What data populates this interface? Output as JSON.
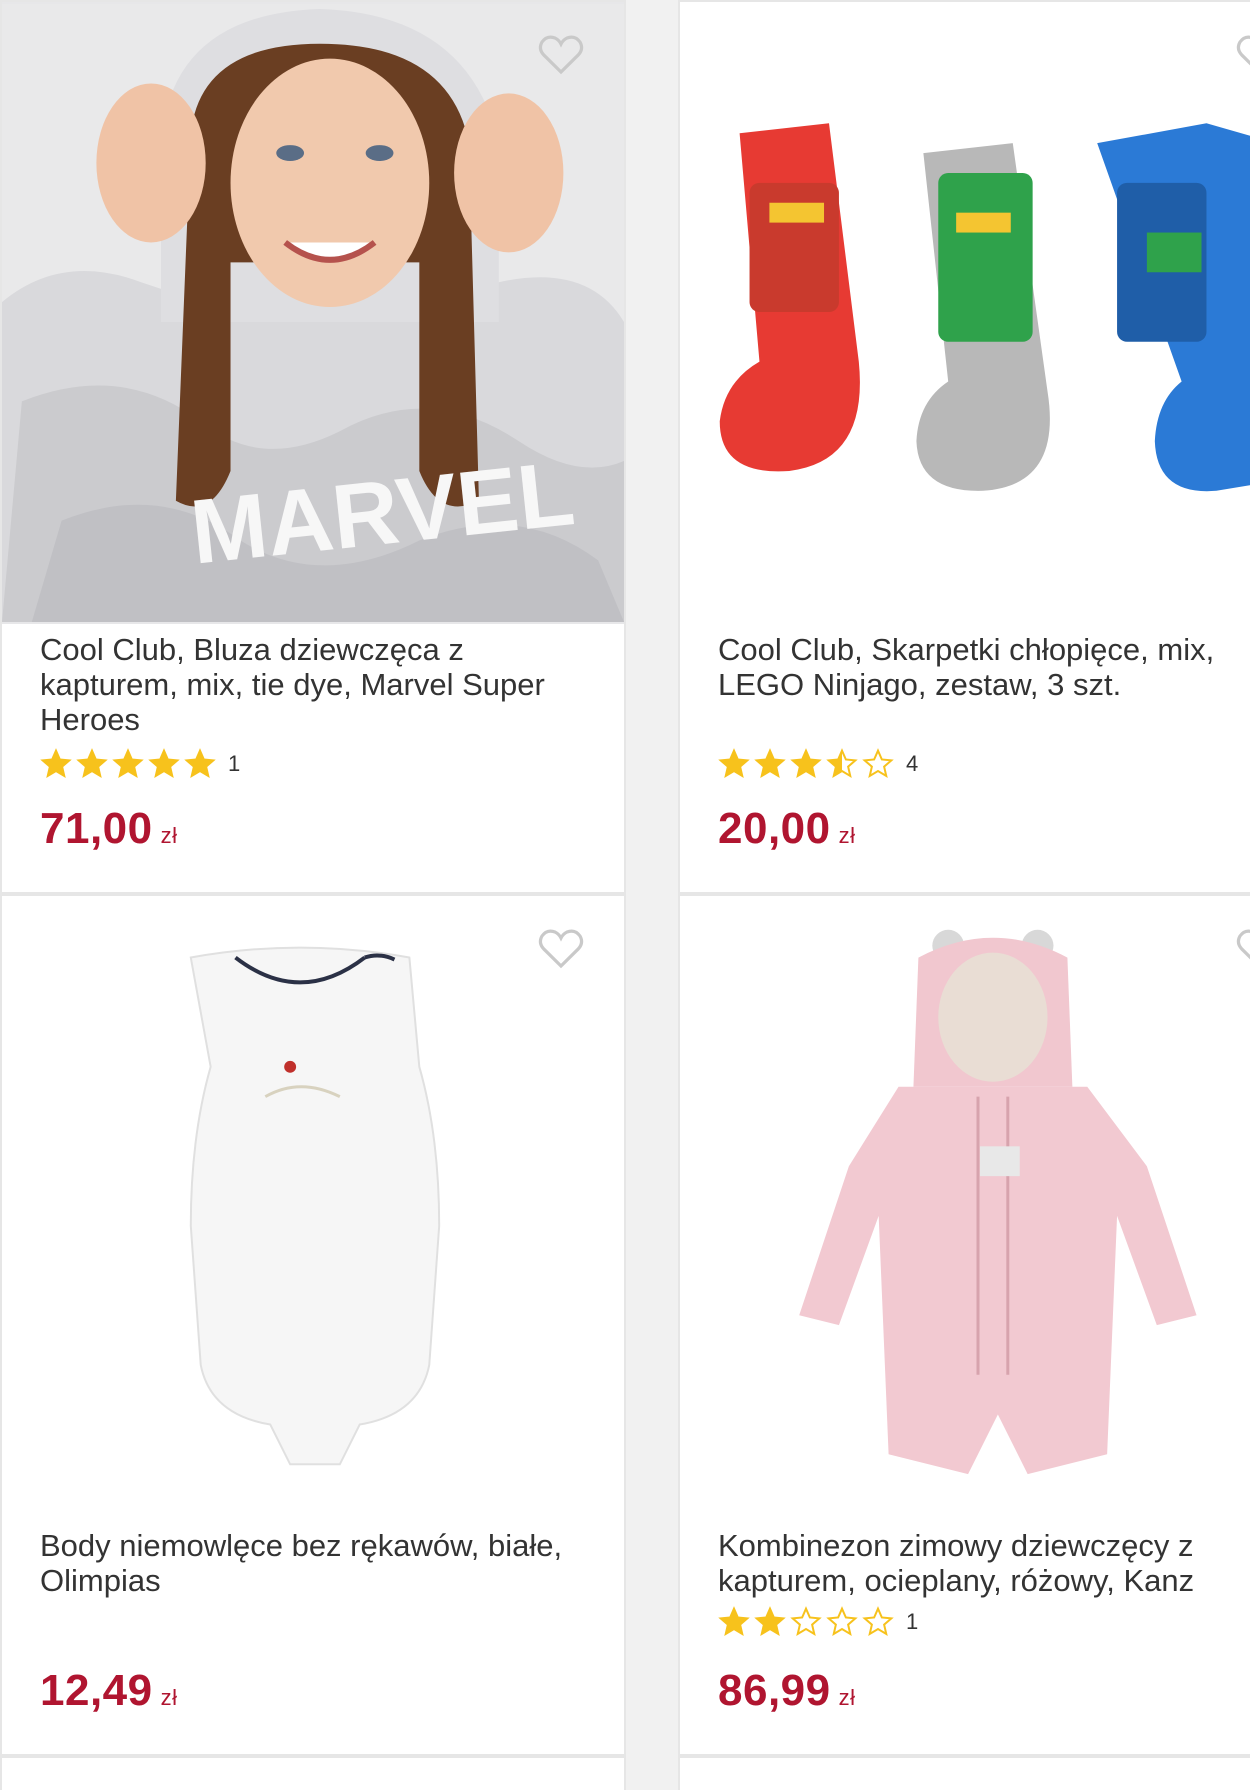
{
  "colors": {
    "price": "#b01530",
    "star_filled": "#f7c21c",
    "star_empty_stroke": "#f7c21c"
  },
  "products": [
    {
      "title": "Cool Club, Bluza dziewczęca z kapturem, mix, tie dye, Marvel Super Heroes",
      "rating_stars": 5,
      "rating_count": "1",
      "price": "71,00",
      "currency": "zł",
      "image": "girl-in-marvel-tie-dye-hoodie"
    },
    {
      "title": "Cool Club, Skarpetki chłopięce, mix, LEGO Ninjago, zestaw, 3 szt.",
      "rating_stars": 3.5,
      "rating_count": "4",
      "price": "20,00",
      "currency": "zł",
      "image": "three-pairs-of-ninjago-socks"
    },
    {
      "title": "Body niemowlęce bez rękawów, białe, Olimpias",
      "rating_stars": 0,
      "rating_count": "",
      "price": "12,49",
      "currency": "zł",
      "image": "white-sleeveless-baby-bodysuit"
    },
    {
      "title": "Kombinezon zimowy dziewczęcy z kapturem, ocieplany, różowy, Kanz",
      "rating_stars": 2,
      "rating_count": "1",
      "price": "86,99",
      "currency": "zł",
      "image": "pink-winter-baby-snowsuit"
    }
  ]
}
